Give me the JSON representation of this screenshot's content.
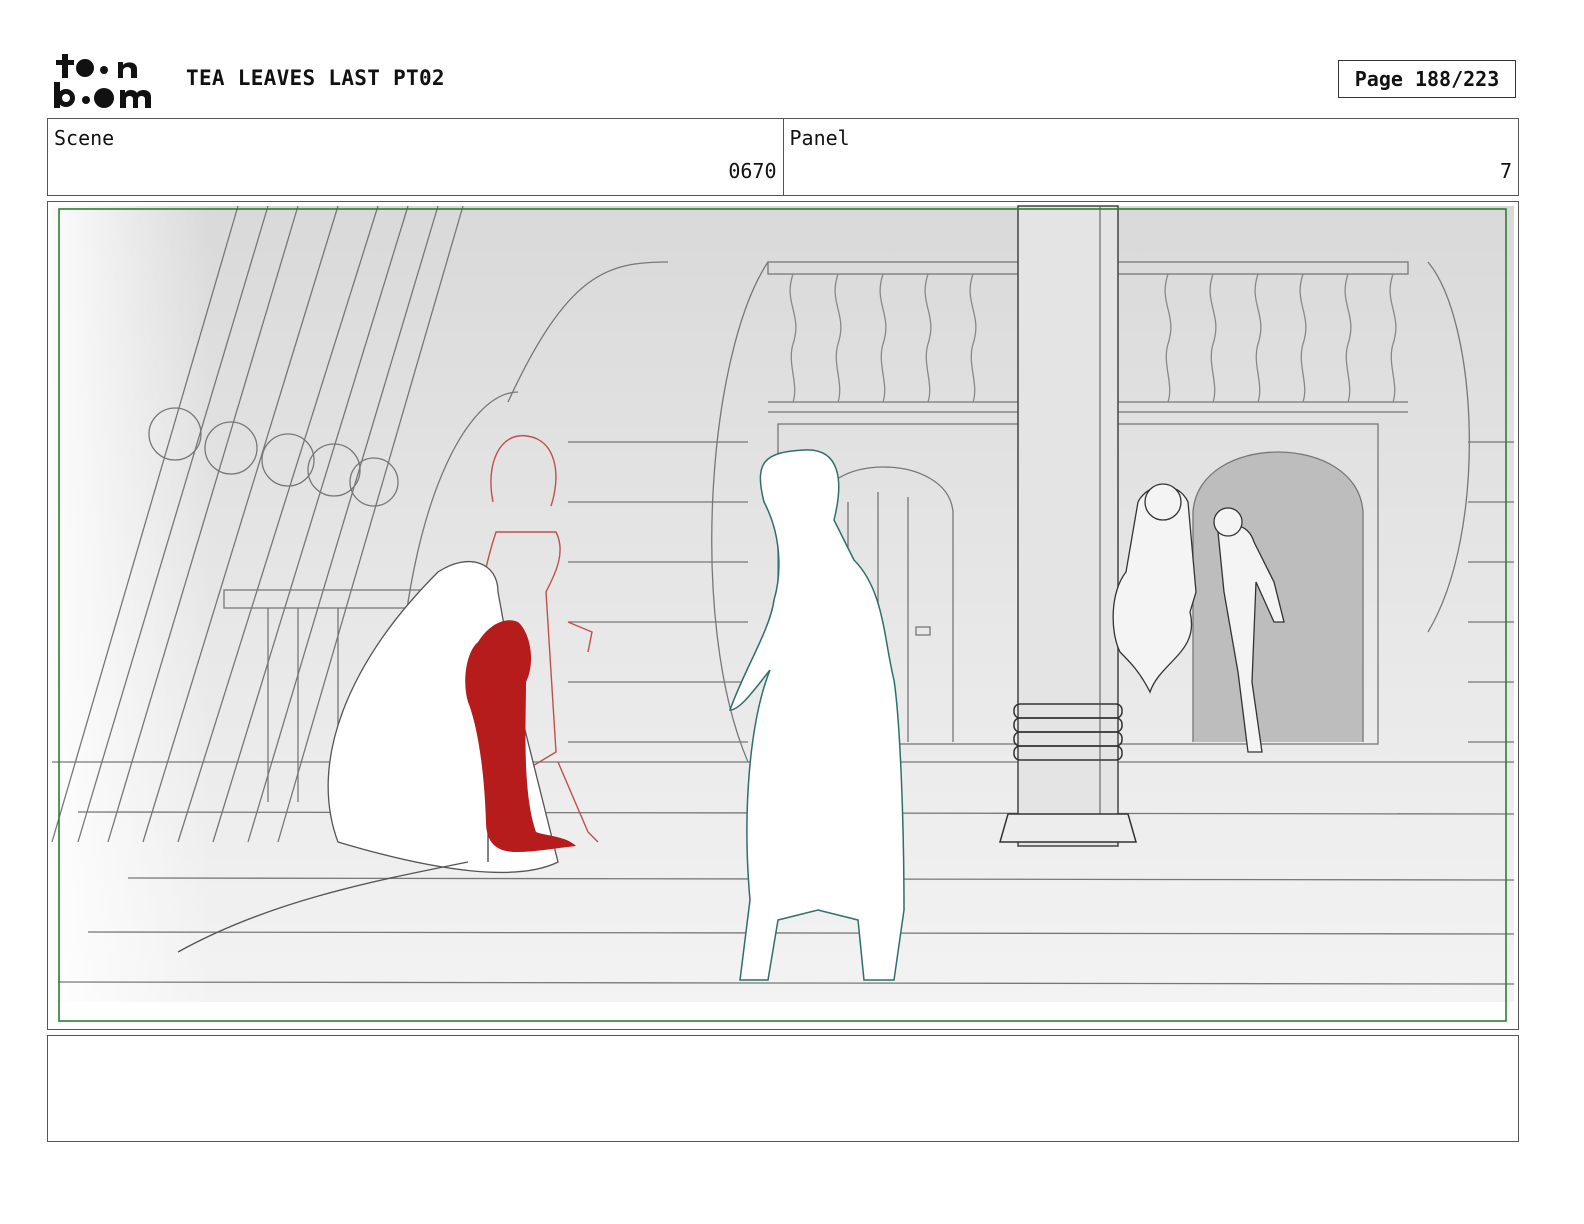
{
  "header": {
    "logo_top": "toon",
    "logo_bottom": "boom",
    "title": "TEA LEAVES LAST PT02",
    "page": "Page 188/223"
  },
  "info": {
    "scene_label": "Scene",
    "scene_value": "0670",
    "panel_label": "Panel",
    "panel_value": "7"
  },
  "colors": {
    "safe_frame": "#2e7d32",
    "blood": "#b71c1c",
    "red_character": "#c0504d",
    "teal_character": "#2f6f6a"
  },
  "notes": ""
}
